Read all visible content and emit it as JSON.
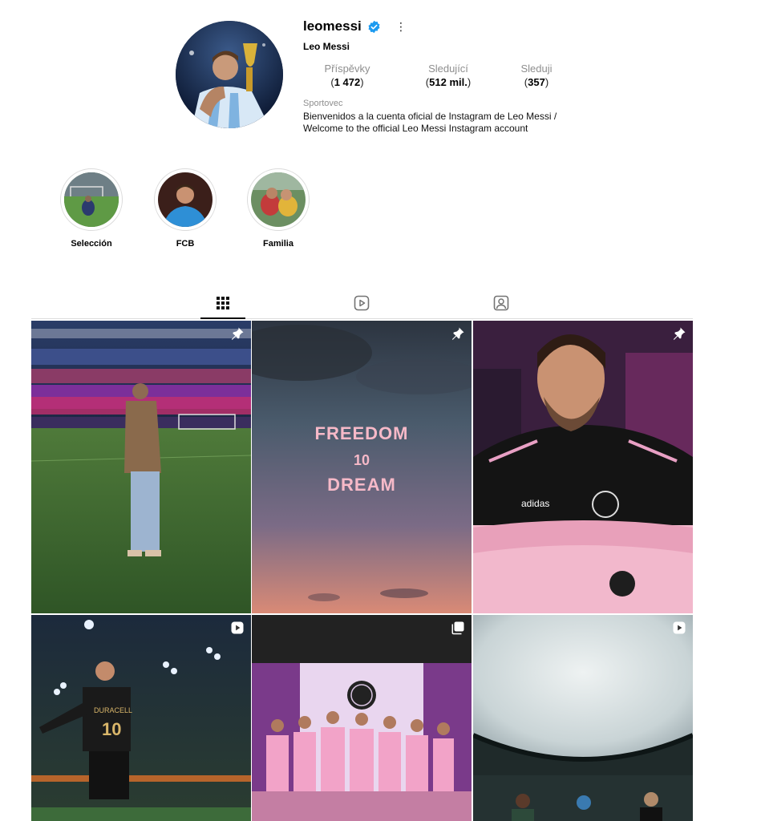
{
  "profile": {
    "username": "leomessi",
    "more_glyph": "⋮",
    "full_name": "Leo Messi",
    "category": "Sportovec",
    "bio_line1": "Bienvenidos a la cuenta oficial de Instagram de Leo Messi /",
    "bio_line2": "Welcome to the official Leo Messi Instagram account",
    "verified_color": "#1d9bf0"
  },
  "stats": {
    "posts_label": "Příspěvky",
    "posts_value": "1 472",
    "followers_label": "Sledující",
    "followers_value": "512 mil.",
    "following_label": "Sleduji",
    "following_value": "357"
  },
  "highlights": [
    {
      "label": "Selección"
    },
    {
      "label": "FCB"
    },
    {
      "label": "Familia"
    }
  ],
  "tabs": [
    {
      "icon": "grid-icon",
      "active": true
    },
    {
      "icon": "reels-icon",
      "active": false
    },
    {
      "icon": "tagged-icon",
      "active": false
    }
  ],
  "posts": [
    {
      "badge": "pin-icon"
    },
    {
      "badge": "pin-icon",
      "text_line1": "FREEDOM",
      "text_line2": "10",
      "text_line3": "DREAM"
    },
    {
      "badge": "pin-icon"
    },
    {
      "badge": "reel-icon"
    },
    {
      "badge": "carousel-icon"
    },
    {
      "badge": "reel-icon"
    }
  ]
}
